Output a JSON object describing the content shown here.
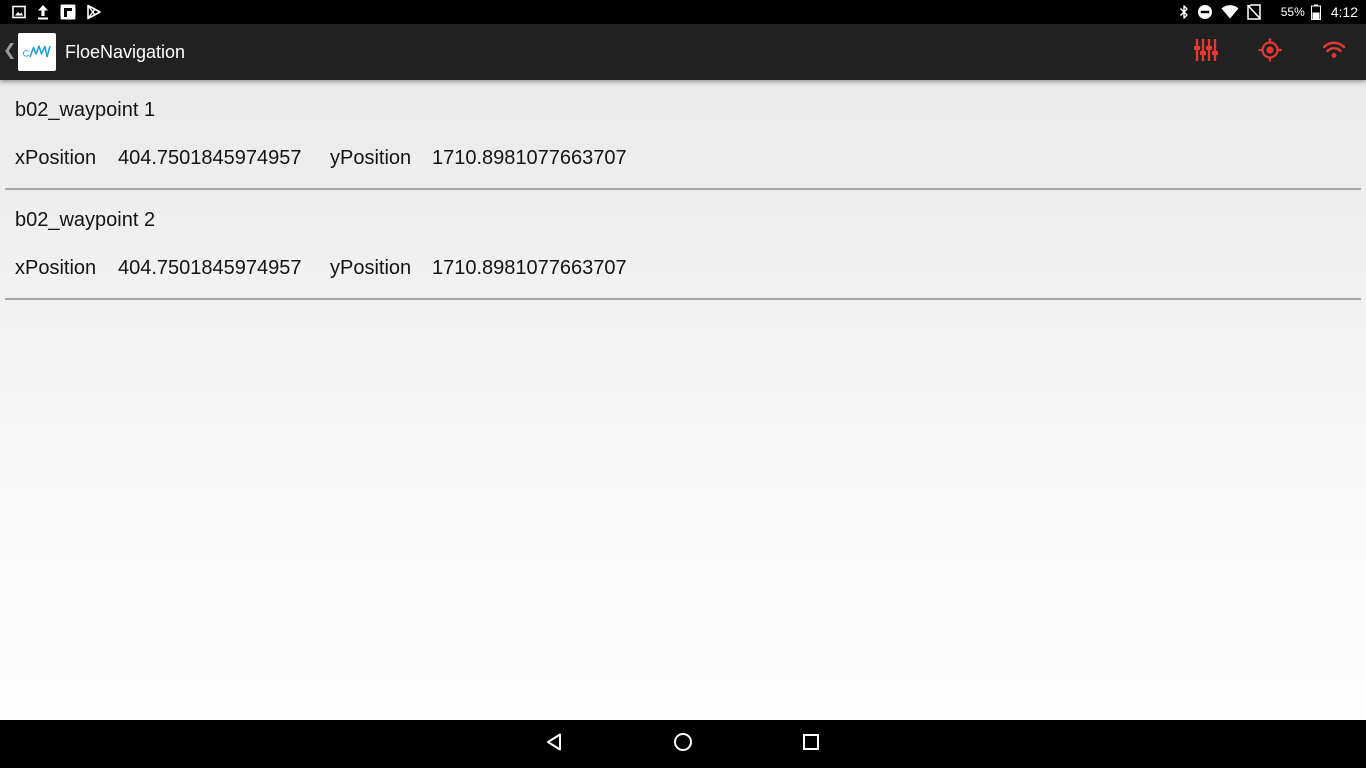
{
  "status_bar": {
    "notification_icons": [
      "gallery-icon",
      "upload-icon",
      "flipboard-icon",
      "play-store-icon"
    ],
    "system_icons": [
      "bluetooth-icon",
      "do-not-disturb-icon",
      "wifi-signal-icon",
      "no-sim-icon"
    ],
    "battery_percent": "55%",
    "time": "4:12"
  },
  "action_bar": {
    "title": "FloeNavigation",
    "logo_icon": "app-logo-icon",
    "actions": [
      "sliders-icon",
      "gps-target-icon",
      "wifi-icon"
    ],
    "accent_color": "#e53935"
  },
  "waypoints": [
    {
      "name": "b02_waypoint 1",
      "x_label": "xPosition",
      "x_value": "404.7501845974957",
      "y_label": "yPosition",
      "y_value": "1710.8981077663707"
    },
    {
      "name": "b02_waypoint 2",
      "x_label": "xPosition",
      "x_value": "404.7501845974957",
      "y_label": "yPosition",
      "y_value": "1710.8981077663707"
    }
  ],
  "nav_bar": {
    "buttons": [
      "back-icon",
      "home-icon",
      "recents-icon"
    ]
  }
}
